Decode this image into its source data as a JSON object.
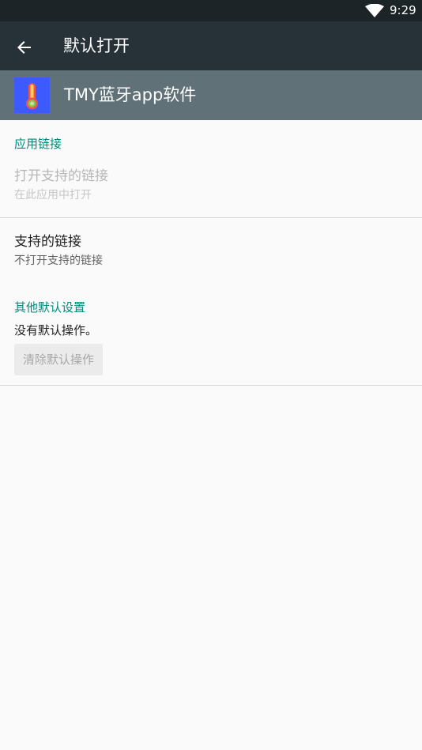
{
  "status_bar": {
    "time": "9:29",
    "icons": [
      "wifi-icon"
    ]
  },
  "toolbar": {
    "back_icon": "arrow-back-icon",
    "title": "默认打开"
  },
  "app": {
    "name": "TMY蓝牙app软件",
    "icon": "thermometer-icon"
  },
  "sections": {
    "app_links": {
      "title": "应用链接",
      "open_supported": {
        "title": "打开支持的链接",
        "subtitle": "在此应用中打开"
      },
      "supported_links": {
        "title": "支持的链接",
        "subtitle": "不打开支持的链接"
      }
    },
    "other_defaults": {
      "title": "其他默认设置",
      "status": "没有默认操作。",
      "clear_button": "清除默认操作"
    }
  },
  "colors": {
    "status_bar": "#1c2428",
    "toolbar": "#263238",
    "app_header": "#607177",
    "accent": "#00897b",
    "background": "#fafafa"
  }
}
